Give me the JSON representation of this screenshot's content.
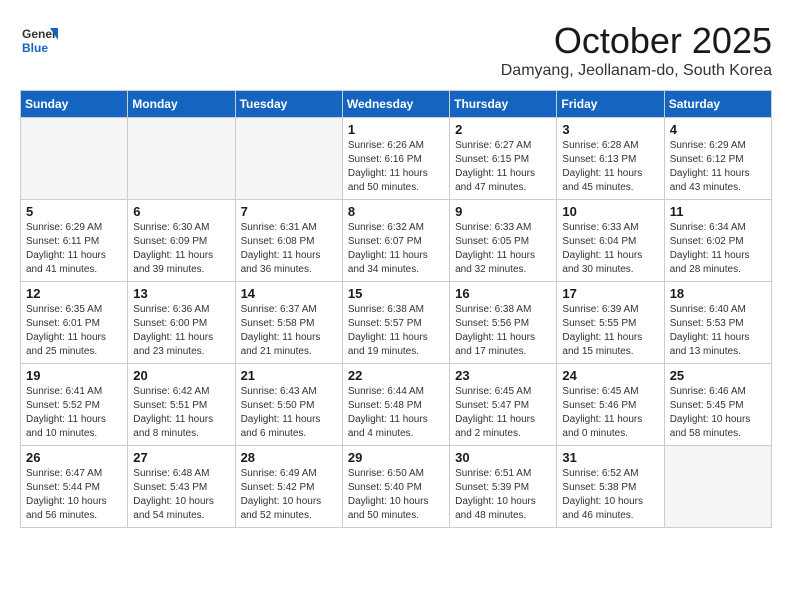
{
  "header": {
    "logo_general": "General",
    "logo_blue": "Blue",
    "month_title": "October 2025",
    "location": "Damyang, Jeollanam-do, South Korea"
  },
  "days_of_week": [
    "Sunday",
    "Monday",
    "Tuesday",
    "Wednesday",
    "Thursday",
    "Friday",
    "Saturday"
  ],
  "weeks": [
    [
      {
        "day": "",
        "info": ""
      },
      {
        "day": "",
        "info": ""
      },
      {
        "day": "",
        "info": ""
      },
      {
        "day": "1",
        "info": "Sunrise: 6:26 AM\nSunset: 6:16 PM\nDaylight: 11 hours\nand 50 minutes."
      },
      {
        "day": "2",
        "info": "Sunrise: 6:27 AM\nSunset: 6:15 PM\nDaylight: 11 hours\nand 47 minutes."
      },
      {
        "day": "3",
        "info": "Sunrise: 6:28 AM\nSunset: 6:13 PM\nDaylight: 11 hours\nand 45 minutes."
      },
      {
        "day": "4",
        "info": "Sunrise: 6:29 AM\nSunset: 6:12 PM\nDaylight: 11 hours\nand 43 minutes."
      }
    ],
    [
      {
        "day": "5",
        "info": "Sunrise: 6:29 AM\nSunset: 6:11 PM\nDaylight: 11 hours\nand 41 minutes."
      },
      {
        "day": "6",
        "info": "Sunrise: 6:30 AM\nSunset: 6:09 PM\nDaylight: 11 hours\nand 39 minutes."
      },
      {
        "day": "7",
        "info": "Sunrise: 6:31 AM\nSunset: 6:08 PM\nDaylight: 11 hours\nand 36 minutes."
      },
      {
        "day": "8",
        "info": "Sunrise: 6:32 AM\nSunset: 6:07 PM\nDaylight: 11 hours\nand 34 minutes."
      },
      {
        "day": "9",
        "info": "Sunrise: 6:33 AM\nSunset: 6:05 PM\nDaylight: 11 hours\nand 32 minutes."
      },
      {
        "day": "10",
        "info": "Sunrise: 6:33 AM\nSunset: 6:04 PM\nDaylight: 11 hours\nand 30 minutes."
      },
      {
        "day": "11",
        "info": "Sunrise: 6:34 AM\nSunset: 6:02 PM\nDaylight: 11 hours\nand 28 minutes."
      }
    ],
    [
      {
        "day": "12",
        "info": "Sunrise: 6:35 AM\nSunset: 6:01 PM\nDaylight: 11 hours\nand 25 minutes."
      },
      {
        "day": "13",
        "info": "Sunrise: 6:36 AM\nSunset: 6:00 PM\nDaylight: 11 hours\nand 23 minutes."
      },
      {
        "day": "14",
        "info": "Sunrise: 6:37 AM\nSunset: 5:58 PM\nDaylight: 11 hours\nand 21 minutes."
      },
      {
        "day": "15",
        "info": "Sunrise: 6:38 AM\nSunset: 5:57 PM\nDaylight: 11 hours\nand 19 minutes."
      },
      {
        "day": "16",
        "info": "Sunrise: 6:38 AM\nSunset: 5:56 PM\nDaylight: 11 hours\nand 17 minutes."
      },
      {
        "day": "17",
        "info": "Sunrise: 6:39 AM\nSunset: 5:55 PM\nDaylight: 11 hours\nand 15 minutes."
      },
      {
        "day": "18",
        "info": "Sunrise: 6:40 AM\nSunset: 5:53 PM\nDaylight: 11 hours\nand 13 minutes."
      }
    ],
    [
      {
        "day": "19",
        "info": "Sunrise: 6:41 AM\nSunset: 5:52 PM\nDaylight: 11 hours\nand 10 minutes."
      },
      {
        "day": "20",
        "info": "Sunrise: 6:42 AM\nSunset: 5:51 PM\nDaylight: 11 hours\nand 8 minutes."
      },
      {
        "day": "21",
        "info": "Sunrise: 6:43 AM\nSunset: 5:50 PM\nDaylight: 11 hours\nand 6 minutes."
      },
      {
        "day": "22",
        "info": "Sunrise: 6:44 AM\nSunset: 5:48 PM\nDaylight: 11 hours\nand 4 minutes."
      },
      {
        "day": "23",
        "info": "Sunrise: 6:45 AM\nSunset: 5:47 PM\nDaylight: 11 hours\nand 2 minutes."
      },
      {
        "day": "24",
        "info": "Sunrise: 6:45 AM\nSunset: 5:46 PM\nDaylight: 11 hours\nand 0 minutes."
      },
      {
        "day": "25",
        "info": "Sunrise: 6:46 AM\nSunset: 5:45 PM\nDaylight: 10 hours\nand 58 minutes."
      }
    ],
    [
      {
        "day": "26",
        "info": "Sunrise: 6:47 AM\nSunset: 5:44 PM\nDaylight: 10 hours\nand 56 minutes."
      },
      {
        "day": "27",
        "info": "Sunrise: 6:48 AM\nSunset: 5:43 PM\nDaylight: 10 hours\nand 54 minutes."
      },
      {
        "day": "28",
        "info": "Sunrise: 6:49 AM\nSunset: 5:42 PM\nDaylight: 10 hours\nand 52 minutes."
      },
      {
        "day": "29",
        "info": "Sunrise: 6:50 AM\nSunset: 5:40 PM\nDaylight: 10 hours\nand 50 minutes."
      },
      {
        "day": "30",
        "info": "Sunrise: 6:51 AM\nSunset: 5:39 PM\nDaylight: 10 hours\nand 48 minutes."
      },
      {
        "day": "31",
        "info": "Sunrise: 6:52 AM\nSunset: 5:38 PM\nDaylight: 10 hours\nand 46 minutes."
      },
      {
        "day": "",
        "info": ""
      }
    ]
  ]
}
